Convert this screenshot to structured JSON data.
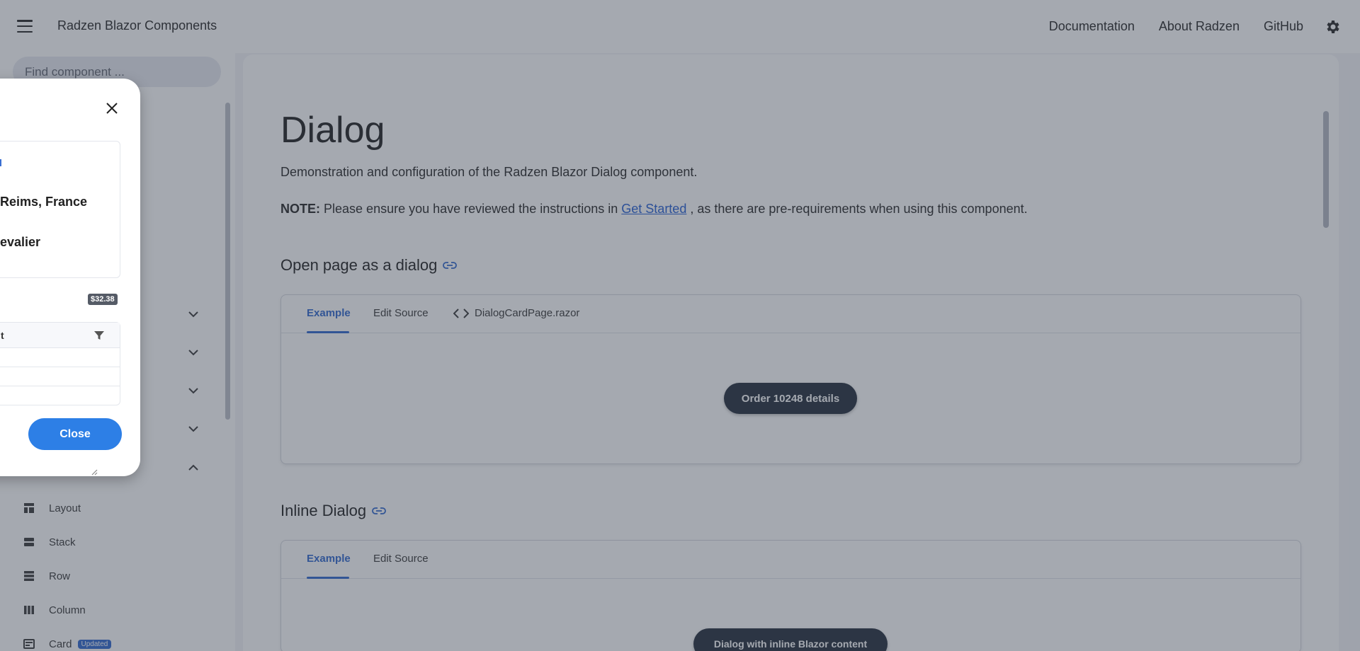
{
  "header": {
    "title": "Radzen Blazor Components",
    "nav": [
      "Documentation",
      "About Radzen",
      "GitHub"
    ]
  },
  "sidebar": {
    "search_placeholder": "Find component ...",
    "items": [
      {
        "label": "Layout",
        "icon": "layout-icon"
      },
      {
        "label": "Stack",
        "icon": "stack-icon"
      },
      {
        "label": "Row",
        "icon": "row-icon"
      },
      {
        "label": "Column",
        "icon": "column-icon"
      },
      {
        "label": "Card",
        "icon": "card-icon",
        "badge": "Updated"
      }
    ]
  },
  "main": {
    "title": "Dialog",
    "description": "Demonstration and configuration of the Radzen Blazor Dialog component.",
    "note": {
      "label": "NOTE:",
      "before": "Please ensure you have reviewed the instructions in",
      "link": "Get Started",
      "after": ", as there are pre-requirements when using this component."
    },
    "sections": [
      {
        "heading": "Open page as a dialog",
        "tabs": [
          "Example",
          "Edit Source",
          "DialogCardPage.razor"
        ],
        "button": "Order 10248 details"
      },
      {
        "heading": "Inline Dialog",
        "tabs": [
          "Example",
          "Edit Source"
        ],
        "button": "Dialog with inline Blazor content"
      }
    ]
  },
  "dialog": {
    "lines": [
      "Reims, France",
      "evalier"
    ],
    "price": "$32.38",
    "grid_header": "t",
    "close_label": "Close"
  },
  "colors": {
    "accent": "#3a6fd1",
    "primary_button": "#2d7fe6",
    "overlay": "rgba(40,50,66,0.42)"
  }
}
